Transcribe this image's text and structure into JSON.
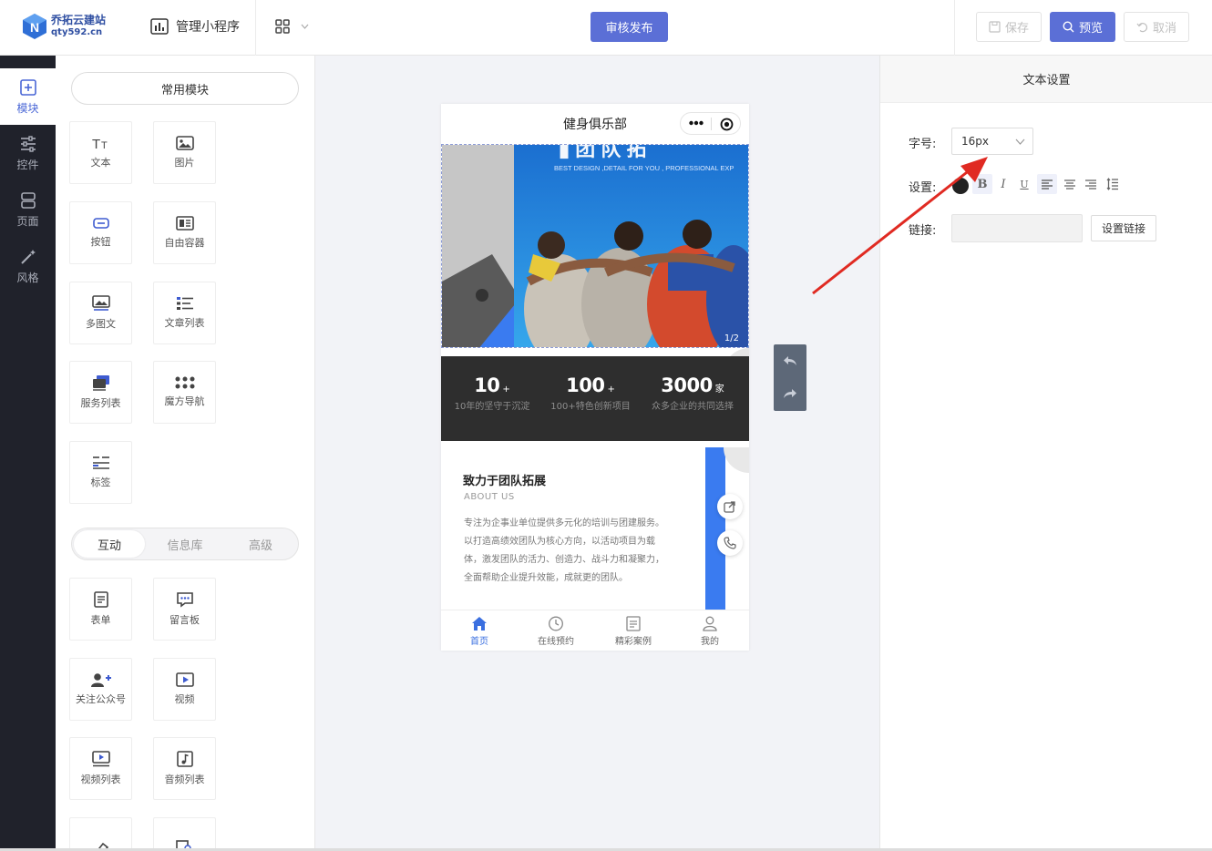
{
  "brand": {
    "name": "乔拓云建站",
    "domain": "qty592.cn"
  },
  "topbar": {
    "mini_program_label": "管理小程序",
    "publish_label": "审核发布",
    "save_label": "保存",
    "preview_label": "预览",
    "cancel_label": "取消",
    "accent_color": "#5b6fd6"
  },
  "rail": {
    "items": [
      {
        "label": "模块",
        "icon": "plus-square-icon",
        "active": true
      },
      {
        "label": "控件",
        "icon": "sliders-icon"
      },
      {
        "label": "页面",
        "icon": "pages-icon"
      },
      {
        "label": "风格",
        "icon": "magic-wand-icon"
      }
    ]
  },
  "modules": {
    "common_header": "常用模块",
    "common": [
      {
        "label": "文本",
        "icon": "text-icon"
      },
      {
        "label": "图片",
        "icon": "image-icon"
      },
      {
        "label": "按钮",
        "icon": "button-icon"
      },
      {
        "label": "自由容器",
        "icon": "container-icon"
      },
      {
        "label": "多图文",
        "icon": "multi-image-text-icon"
      },
      {
        "label": "文章列表",
        "icon": "article-list-icon"
      },
      {
        "label": "服务列表",
        "icon": "service-list-icon"
      },
      {
        "label": "魔方导航",
        "icon": "cube-nav-icon"
      },
      {
        "label": "标签",
        "icon": "tag-icon"
      }
    ],
    "tabs": [
      "互动",
      "信息库",
      "高级"
    ],
    "interactive": [
      {
        "label": "表单",
        "icon": "form-icon"
      },
      {
        "label": "留言板",
        "icon": "message-board-icon"
      },
      {
        "label": "关注公众号",
        "icon": "follow-account-icon"
      },
      {
        "label": "视频",
        "icon": "video-icon"
      },
      {
        "label": "视频列表",
        "icon": "video-list-icon"
      },
      {
        "label": "音频列表",
        "icon": "audio-list-icon"
      }
    ]
  },
  "phone": {
    "title": "健身俱乐部",
    "banner_text": "BEST DESIGN ,DETAIL FOR YOU , PROFESSIONAL EXP",
    "banner_counter": "1/2",
    "stats": [
      {
        "num": "10",
        "suffix": "+",
        "label": "10年的坚守于沉淀"
      },
      {
        "num": "100",
        "suffix": "+",
        "label": "100+特色创新项目"
      },
      {
        "num": "3000",
        "suffix": "家",
        "label": "众多企业的共同选择"
      }
    ],
    "about": {
      "title": "致力于团队拓展",
      "subtitle": "ABOUT US",
      "lines": [
        "专注为企事业单位提供多元化的培训与团建服务。",
        "以打造高绩效团队为核心方向，以活动项目为载",
        "体，激发团队的活力、创造力、战斗力和凝聚力，",
        "全面帮助企业提升效能，成就更的团队。"
      ]
    },
    "tabs": [
      {
        "label": "首页",
        "icon": "home-icon",
        "active": true
      },
      {
        "label": "在线预约",
        "icon": "clock-icon"
      },
      {
        "label": "精彩案例",
        "icon": "document-icon"
      },
      {
        "label": "我的",
        "icon": "user-icon"
      }
    ]
  },
  "settings": {
    "header": "文本设置",
    "font_size_label": "字号:",
    "font_size_value": "16px",
    "style_label": "设置:",
    "format_buttons": [
      "B",
      "I",
      "U"
    ],
    "link_label": "链接:",
    "link_value": "",
    "set_link_label": "设置链接"
  }
}
